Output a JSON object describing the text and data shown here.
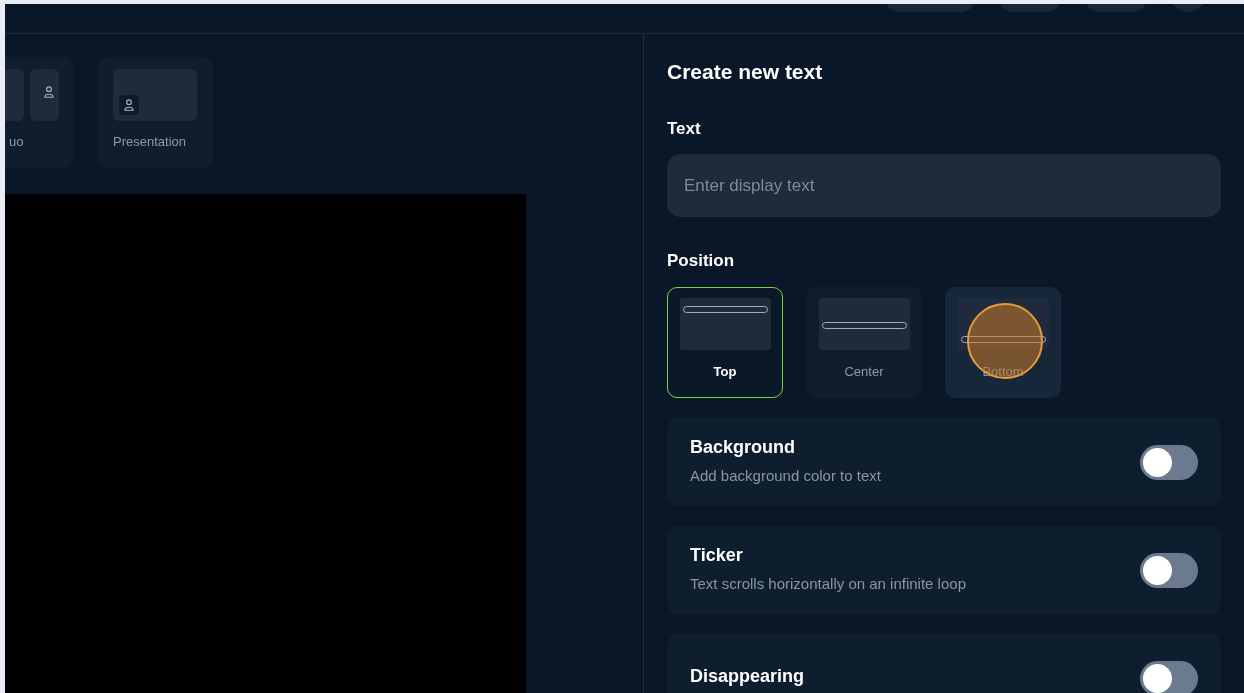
{
  "toolbar": {
    "buttons": [
      {
        "kind": "pill"
      },
      {
        "kind": "pill"
      },
      {
        "kind": "pill"
      },
      {
        "kind": "round"
      }
    ]
  },
  "layouts": [
    {
      "label": "uo",
      "kind": "duo",
      "selected": false
    },
    {
      "label": "Presentation",
      "kind": "presentation",
      "selected": false
    }
  ],
  "panel": {
    "title": "Create new text",
    "text_label": "Text",
    "text_field": {
      "placeholder": "Enter display text"
    },
    "position_label": "Position",
    "positions": [
      {
        "label": "Top",
        "kind": "top",
        "selected": true,
        "hovered": false
      },
      {
        "label": "Center",
        "kind": "center",
        "selected": false,
        "hovered": false
      },
      {
        "label": "Bottom",
        "kind": "bottom",
        "selected": false,
        "hovered": true
      }
    ],
    "options": [
      {
        "title": "Background",
        "description": "Add background color to text",
        "on": false
      },
      {
        "title": "Ticker",
        "description": "Text scrolls horizontally on an infinite loop",
        "on": false
      },
      {
        "title": "Disappearing",
        "on": false
      }
    ]
  },
  "click_indicator": {
    "on": true
  }
}
